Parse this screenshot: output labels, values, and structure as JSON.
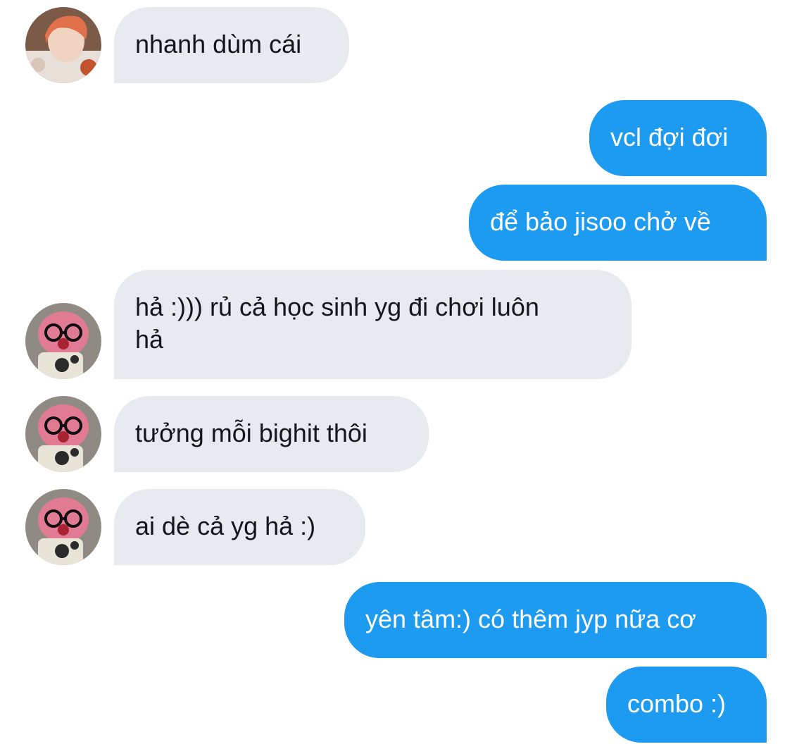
{
  "messages": [
    {
      "direction": "incoming",
      "sender_avatar": "orange-hair-person-avatar",
      "text": "nhanh dùm cái"
    },
    {
      "direction": "outgoing",
      "text": "vcl đợi đơi"
    },
    {
      "direction": "outgoing",
      "text": "để bảo jisoo chở về"
    },
    {
      "direction": "incoming",
      "sender_avatar": "pink-plush-glasses-avatar",
      "text_line1": "hả :))) rủ cả học sinh yg đi chơi luôn",
      "text_line2": "hả"
    },
    {
      "direction": "incoming",
      "sender_avatar": "pink-plush-glasses-avatar",
      "text": "tưởng mỗi bighit thôi"
    },
    {
      "direction": "incoming",
      "sender_avatar": "pink-plush-glasses-avatar",
      "text": "ai dè cả yg hả :)"
    },
    {
      "direction": "outgoing",
      "text": "yên tâm:) có thêm jyp nữa cơ"
    },
    {
      "direction": "outgoing",
      "text": "combo :)"
    }
  ],
  "colors": {
    "incoming_bubble": "#e7ebef",
    "incoming_text": "#14171a",
    "outgoing_bubble": "#1d9bf0",
    "outgoing_text": "#ffffff",
    "background": "#ffffff"
  }
}
